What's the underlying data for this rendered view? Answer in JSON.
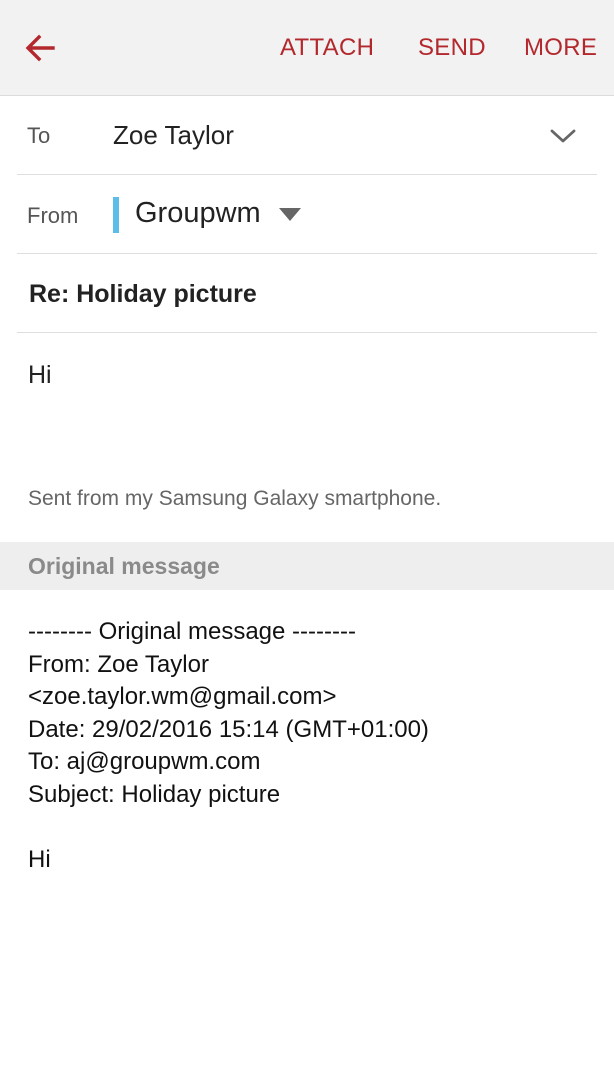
{
  "toolbar": {
    "back_icon": "arrow-left-icon",
    "actions": [
      "ATTACH",
      "SEND",
      "MORE"
    ],
    "accent_color": "#b3282d"
  },
  "compose": {
    "to_label": "To",
    "to_value": "Zoe Taylor",
    "expand_icon": "chevron-down-icon",
    "from_label": "From",
    "from_value": "Groupwm",
    "account_color": "#5bbde8",
    "from_dropdown_icon": "caret-down-icon",
    "subject": "Re: Holiday picture",
    "body": "Hi",
    "signature": "Sent from my Samsung Galaxy smartphone."
  },
  "original": {
    "section_title": "Original message",
    "lines": [
      "-------- Original message --------",
      "From: Zoe Taylor",
      "<zoe.taylor.wm@gmail.com>",
      "Date: 29/02/2016 15:14 (GMT+01:00)",
      "To: aj@groupwm.com",
      "Subject: Holiday picture",
      "",
      "Hi"
    ]
  }
}
